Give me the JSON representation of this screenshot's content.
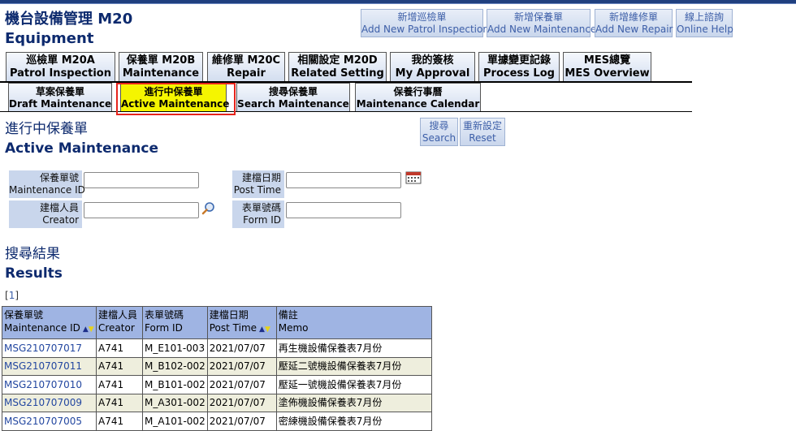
{
  "header": {
    "title_zh": "機台設備管理 M20",
    "title_en": "Equipment"
  },
  "actions": [
    {
      "zh": "新增巡檢單",
      "en": "Add New Patrol Inspection"
    },
    {
      "zh": "新增保養單",
      "en": "Add New Maintenance"
    },
    {
      "zh": "新增維修單",
      "en": "Add New Repair"
    },
    {
      "zh": "線上諮詢",
      "en": "Online Help"
    }
  ],
  "main_tabs": [
    {
      "zh": "巡檢單 M20A",
      "en": "Patrol Inspection"
    },
    {
      "zh": "保養單 M20B",
      "en": "Maintenance"
    },
    {
      "zh": "維修單 M20C",
      "en": "Repair"
    },
    {
      "zh": "相關設定 M20D",
      "en": "Related Setting"
    },
    {
      "zh": "我的簽核",
      "en": "My Approval"
    },
    {
      "zh": "單據變更記錄",
      "en": "Process Log"
    },
    {
      "zh": "MES總覽",
      "en": "MES Overview"
    }
  ],
  "sub_tabs": [
    {
      "zh": "草案保養單",
      "en": "Draft Maintenance"
    },
    {
      "zh": "進行中保養單",
      "en": "Active Maintenance"
    },
    {
      "zh": "搜尋保養單",
      "en": "Search Maintenance"
    },
    {
      "zh": "保養行事曆",
      "en": "Maintenance Calendar"
    }
  ],
  "page": {
    "title_zh": "進行中保養單",
    "title_en": "Active Maintenance"
  },
  "buttons": {
    "search": {
      "zh": "搜尋",
      "en": "Search"
    },
    "reset": {
      "zh": "重新設定",
      "en": "Reset"
    }
  },
  "filters": {
    "maintenance_id": {
      "zh": "保養單號",
      "en": "Maintenance ID",
      "value": ""
    },
    "creator": {
      "zh": "建檔人員",
      "en": "Creator",
      "value": ""
    },
    "post_time": {
      "zh": "建檔日期",
      "en": "Post Time",
      "value": ""
    },
    "form_id": {
      "zh": "表單號碼",
      "en": "Form ID",
      "value": ""
    }
  },
  "results": {
    "title_zh": "搜尋結果",
    "title_en": "Results",
    "pager": "1",
    "columns": [
      {
        "zh": "保養單號",
        "en": "Maintenance ID",
        "sortable": true
      },
      {
        "zh": "建檔人員",
        "en": "Creator",
        "sortable": false
      },
      {
        "zh": "表單號碼",
        "en": "Form ID",
        "sortable": false
      },
      {
        "zh": "建檔日期",
        "en": "Post Time",
        "sortable": true
      },
      {
        "zh": "備註",
        "en": "Memo",
        "sortable": false
      }
    ],
    "rows": [
      {
        "id": "MSG210707017",
        "creator": "A741",
        "form": "M_E101-003",
        "date": "2021/07/07",
        "memo": "再生機設備保養表7月份"
      },
      {
        "id": "MSG210707011",
        "creator": "A741",
        "form": "M_B102-002",
        "date": "2021/07/07",
        "memo": "壓延二號機設備保養表7月份"
      },
      {
        "id": "MSG210707010",
        "creator": "A741",
        "form": "M_B101-002",
        "date": "2021/07/07",
        "memo": "壓延一號機設備保養表7月份"
      },
      {
        "id": "MSG210707009",
        "creator": "A741",
        "form": "M_A301-002",
        "date": "2021/07/07",
        "memo": "塗佈機設備保養表7月份"
      },
      {
        "id": "MSG210707005",
        "creator": "A741",
        "form": "M_A101-002",
        "date": "2021/07/07",
        "memo": "密練機設備保養表7月份"
      }
    ]
  },
  "icons": {
    "calendar": "calendar-icon",
    "search": "magnifier-icon"
  },
  "colors": {
    "brand": "#0d2a6e",
    "tab_active": "#f5f500",
    "highlight": "#e6241c",
    "label_bg": "#c9d6ec",
    "header_bg": "#9fb4e3",
    "row_alt": "#eeeedd"
  }
}
